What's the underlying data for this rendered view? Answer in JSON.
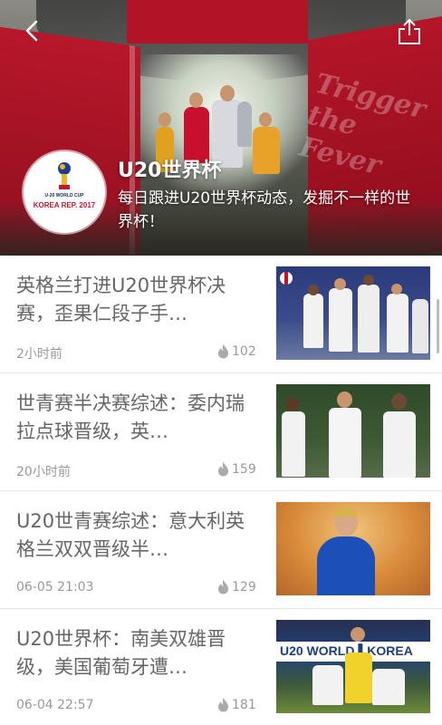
{
  "header": {
    "title": "U20世界杯",
    "description": "每日跟进U20世界杯动态，发掘不一样的世界杯！",
    "logo_line1": "U-20 WORLD CUP",
    "logo_line2": "KOREA REP. 2017",
    "banner_text_top": "Trigger the",
    "banner_text_right": "Trigger the Fever",
    "back_icon": "chevron-left-icon",
    "share_icon": "share-icon"
  },
  "articles": [
    {
      "title": "英格兰打进U20世界杯决赛，歪果仁段子手…",
      "time": "2小时前",
      "hot": "102",
      "thumb_colors": [
        "#2b3a7a",
        "#f2f2f2",
        "#c8102e"
      ]
    },
    {
      "title": "世青赛半决赛综述：委内瑞拉点球晋级，英…",
      "time": "20小时前",
      "hot": "159",
      "thumb_colors": [
        "#2e4a2a",
        "#f2f2f2",
        "#9aa3c0"
      ]
    },
    {
      "title": "U20世青赛综述：意大利英格兰双双晋级半…",
      "time": "06-05 21:03",
      "hot": "129",
      "thumb_colors": [
        "#d98b3a",
        "#1d4fb8",
        "#f0c27a"
      ]
    },
    {
      "title": "U20世界杯：南美双雄晋级，美国葡萄牙遭…",
      "time": "06-04 22:57",
      "hot": "181",
      "thumb_colors": [
        "#1e3f7a",
        "#f2f2f2",
        "#6c8a3a"
      ]
    }
  ],
  "colors": {
    "title_text": "#666666",
    "meta_text": "#999999",
    "banner_red": "#b8172a"
  }
}
